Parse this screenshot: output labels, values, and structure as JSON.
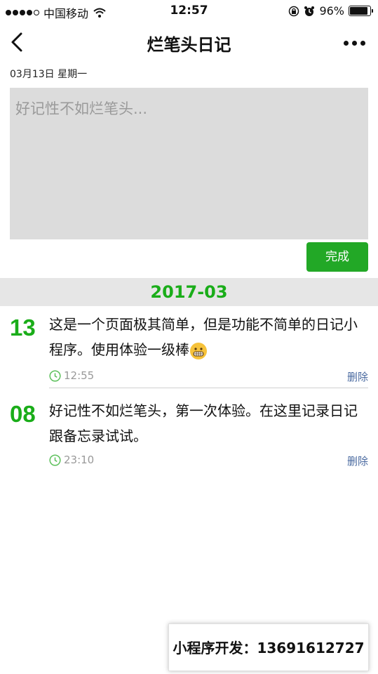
{
  "status_bar": {
    "carrier": "中国移动",
    "time": "12:57",
    "battery": "96%",
    "battery_level": 0.96
  },
  "nav": {
    "title": "烂笔头日记"
  },
  "editor": {
    "date": "03月13日 星期一",
    "placeholder": "好记性不如烂笔头...",
    "submit_label": "完成"
  },
  "diary": {
    "month": "2017-03",
    "entries": [
      {
        "day": "13",
        "text": "这是一个页面极其简单，但是功能不简单的日记小程序。使用体验一级棒",
        "time": "12:55",
        "delete_label": "删除"
      },
      {
        "day": "08",
        "text": "好记性不如烂笔头，第一次体验。在这里记录日记跟备忘录试试。",
        "time": "23:10",
        "delete_label": "删除"
      }
    ]
  },
  "promo": {
    "text": "小程序开发：13691612727"
  },
  "colors": {
    "accent": "#1aad19",
    "button": "#22a826",
    "link": "#4a6aa0",
    "editor_bg": "#dcdcdc"
  }
}
